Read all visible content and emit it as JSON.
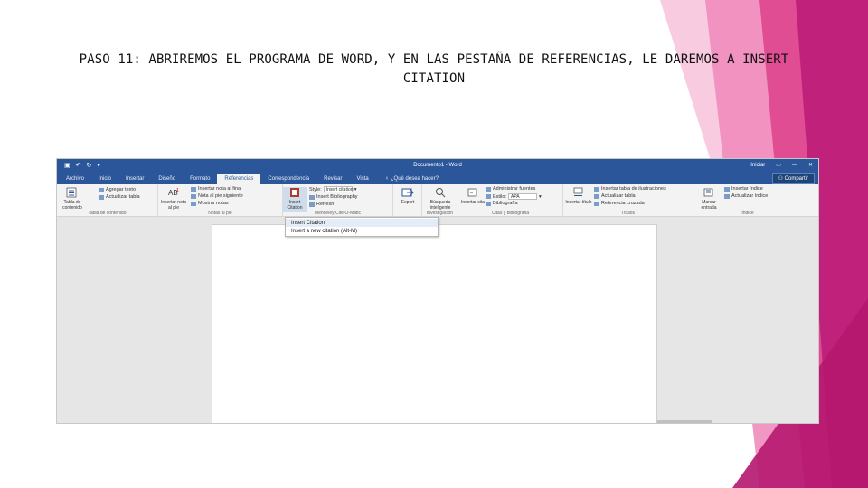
{
  "slide": {
    "title": "PASO 11: ABRIREMOS EL PROGRAMA DE WORD, Y EN LAS PESTAÑA DE REFERENCIAS, LE DAREMOS A INSERT CITATION",
    "accent_colors": [
      "#f4a3cb",
      "#e8559b",
      "#c0217b",
      "#b5176f"
    ]
  },
  "word": {
    "document_title": "Documento1 - Word",
    "user": "Iniciar",
    "window_icon": "restore-icon",
    "quick_access": [
      "save-icon",
      "undo-icon",
      "redo-icon",
      "customize-icon"
    ],
    "tabs": [
      "Archivo",
      "Inicio",
      "Insertar",
      "Diseño",
      "Formato",
      "Referencias",
      "Correspondencia",
      "Revisar",
      "Vista"
    ],
    "active_tab": "Referencias",
    "tell_me": "¿Qué desea hacer?",
    "share": "Compartir",
    "ribbon": {
      "toc": {
        "big": "Tabla de contenido",
        "items": [
          "Agregar texto",
          "Actualizar tabla"
        ],
        "label": "Tabla de contenido"
      },
      "footnotes": {
        "big": "Insertar nota al pie",
        "items": [
          "Insertar nota al final",
          "Nota al pie siguiente",
          "Mostrar notas"
        ],
        "label": "Notas al pie"
      },
      "citations": {
        "big": "Insert Citation",
        "style_label": "Style:",
        "style_value": "Insert citation",
        "items": [
          "Insert Bibliography",
          "Refresh"
        ],
        "label": "Mendeley Cite-O-Matic"
      },
      "export": {
        "big": "Export"
      },
      "research": {
        "big": "Búsqueda inteligente",
        "label": "Investigación"
      },
      "biblio": {
        "big": "Insertar cita",
        "items": [
          "Administrar fuentes",
          "Estilo:",
          "Bibliografía"
        ],
        "style_value": "APA",
        "label": "Citas y bibliografía"
      },
      "captions": {
        "big": "Insertar título",
        "items": [
          "Insertar tabla de ilustraciones",
          "Actualizar tabla",
          "Referencia cruzada"
        ],
        "label": "Títulos"
      },
      "index": {
        "big": "Marcar entrada",
        "items": [
          "Insertar índice",
          "Actualizar índice"
        ],
        "label": "Índice"
      }
    },
    "dropdown": {
      "items": [
        "Insert Citation",
        "Insert a new citation (Alt-M)"
      ]
    }
  }
}
